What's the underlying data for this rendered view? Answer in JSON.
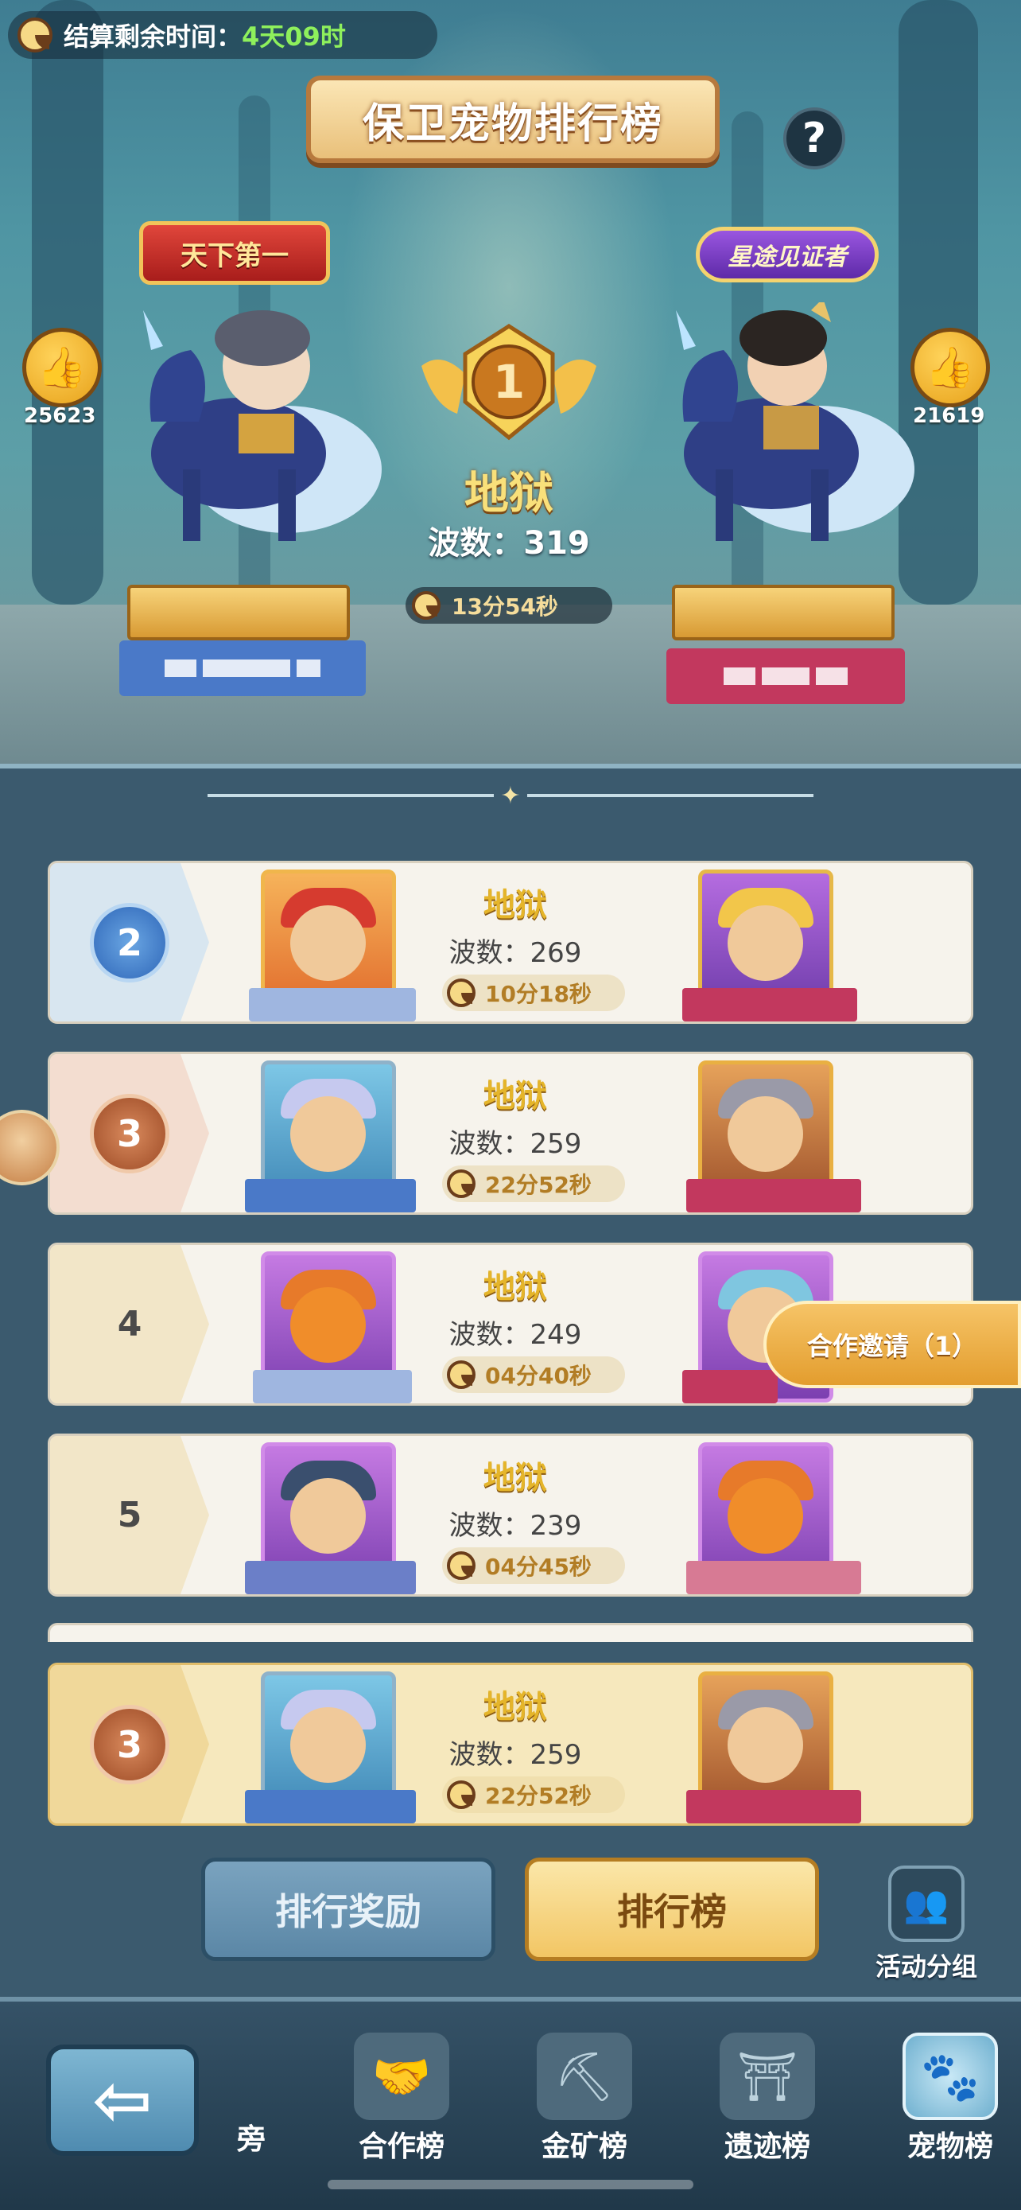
{
  "header": {
    "countdown_label": "结算剩余时间：",
    "countdown_value": "4天09时",
    "title": "保卫宠物排行榜",
    "help_label": "?"
  },
  "top_player": {
    "rank": "1",
    "left_title_badge": "天下第一",
    "right_title_badge": "星途见证者",
    "left_likes": "25623",
    "right_likes": "21619",
    "difficulty": "地狱",
    "wave_text": "波数：319",
    "time": "13分54秒"
  },
  "rows": [
    {
      "rank": "2",
      "difficulty": "地狱",
      "wave_text": "波数：269",
      "time": "10分18秒"
    },
    {
      "rank": "3",
      "difficulty": "地狱",
      "wave_text": "波数：259",
      "time": "22分52秒"
    },
    {
      "rank": "4",
      "difficulty": "地狱",
      "wave_text": "波数：249",
      "time": "04分40秒"
    },
    {
      "rank": "5",
      "difficulty": "地狱",
      "wave_text": "波数：239",
      "time": "04分45秒"
    }
  ],
  "self_row": {
    "rank": "3",
    "difficulty": "地狱",
    "wave_text": "波数：259",
    "time": "22分52秒"
  },
  "invite_label": "合作邀请（1）",
  "tabs": {
    "reward_label": "排行奖励",
    "rank_label": "排行榜",
    "group_label": "活动分组"
  },
  "bottom_nav": {
    "back_symbol": "⇦",
    "partial_label": "旁",
    "items": [
      {
        "label": "合作榜",
        "icon": "handshake-icon"
      },
      {
        "label": "金矿榜",
        "icon": "mine-cart-icon"
      },
      {
        "label": "遗迹榜",
        "icon": "ruins-icon"
      },
      {
        "label": "宠物榜",
        "icon": "paw-icon"
      }
    ],
    "active_index": 3
  },
  "colors": {
    "countdown_green": "#8ef05c",
    "difficulty_gold": "#e5b52a",
    "time_brown": "#b27d25"
  }
}
